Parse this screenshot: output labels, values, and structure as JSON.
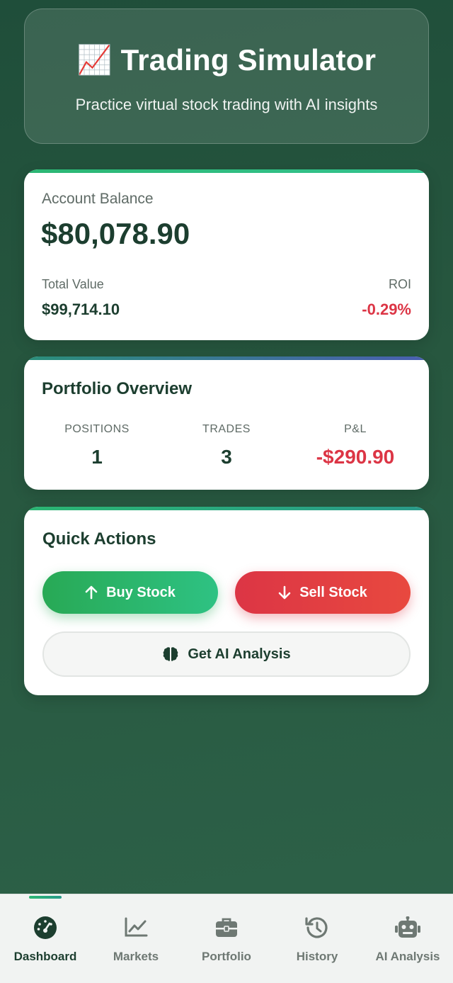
{
  "header": {
    "emoji": "📈",
    "title": "Trading Simulator",
    "subtitle": "Practice virtual stock trading with AI insights"
  },
  "balance": {
    "label": "Account Balance",
    "amount": "$80,078.90",
    "total_value_label": "Total Value",
    "total_value": "$99,714.10",
    "roi_label": "ROI",
    "roi": "-0.29%"
  },
  "portfolio": {
    "title": "Portfolio Overview",
    "stats": [
      {
        "label": "POSITIONS",
        "value": "1"
      },
      {
        "label": "TRADES",
        "value": "3"
      },
      {
        "label": "P&L",
        "value": "-$290.90"
      }
    ]
  },
  "actions": {
    "title": "Quick Actions",
    "buy_label": "Buy Stock",
    "sell_label": "Sell Stock",
    "ai_label": "Get AI Analysis"
  },
  "nav": {
    "items": [
      {
        "label": "Dashboard",
        "icon": "gauge-icon",
        "active": true
      },
      {
        "label": "Markets",
        "icon": "chart-line-icon"
      },
      {
        "label": "Portfolio",
        "icon": "briefcase-icon"
      },
      {
        "label": "History",
        "icon": "history-icon"
      },
      {
        "label": "AI Analysis",
        "icon": "robot-icon"
      }
    ]
  },
  "colors": {
    "primary_dark": "#1c3e2f",
    "buy_green": "#28a955",
    "sell_red": "#dc3545",
    "background": "#27573f"
  }
}
